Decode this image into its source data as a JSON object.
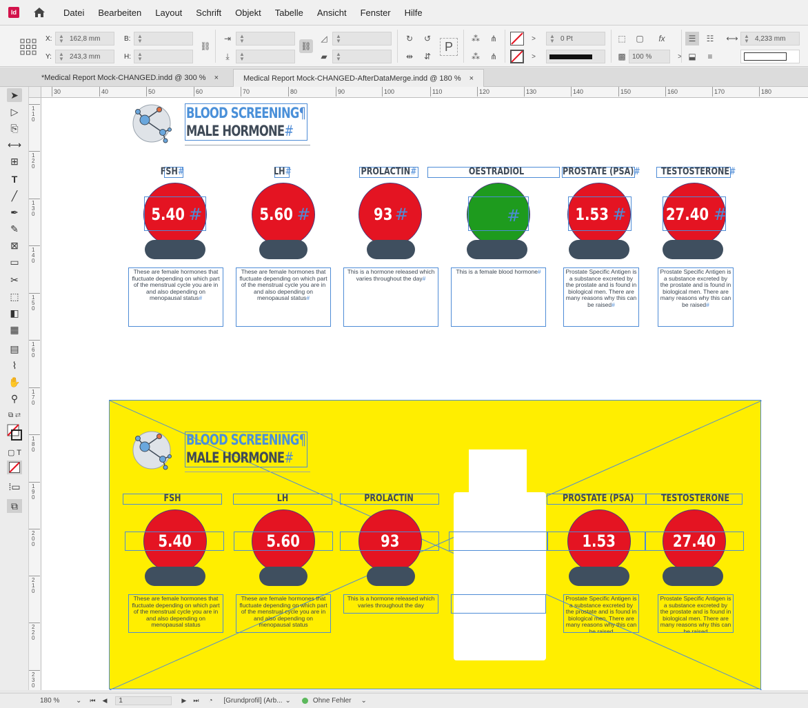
{
  "app": {
    "icon_text": "Id"
  },
  "menu": [
    "Datei",
    "Bearbeiten",
    "Layout",
    "Schrift",
    "Objekt",
    "Tabelle",
    "Ansicht",
    "Fenster",
    "Hilfe"
  ],
  "control": {
    "x_label": "X:",
    "x_value": "162,8 mm",
    "y_label": "Y:",
    "y_value": "243,3 mm",
    "w_label": "B:",
    "h_label": "H:",
    "stroke_weight": "0 Pt",
    "opacity": "100 %",
    "size_value": "4,233 mm"
  },
  "tabs": [
    {
      "label": "*Medical Report Mock-CHANGED.indd @ 300 %",
      "close": "×"
    },
    {
      "label": "Medical Report Mock-CHANGED-AfterDataMerge.indd @ 180 %",
      "close": "×"
    }
  ],
  "ruler": {
    "h_ticks": [
      "30",
      "40",
      "50",
      "60",
      "70",
      "80",
      "90",
      "100",
      "110",
      "120",
      "130",
      "140",
      "150",
      "160",
      "170",
      "180"
    ],
    "v_ticks": [
      "110",
      "120",
      "130",
      "140",
      "150",
      "160",
      "170",
      "180",
      "190",
      "200",
      "210",
      "220",
      "230",
      "240"
    ]
  },
  "report": {
    "title_line1": "BLOOD SCREENING",
    "title_line2": "MALE HORMONE",
    "pilcrow": "¶",
    "hash": "#",
    "hormones": [
      {
        "name": "FSH",
        "value": "5.40",
        "desc": "These are female hormones that fluctuate depending on which part of the menstrual cycle you are in and also depending on menopausal status"
      },
      {
        "name": "LH",
        "value": "5.60",
        "desc": "These are female hormones that fluctuate depending on which part of the menstrual cycle you are in and also depending on menopausal status"
      },
      {
        "name": "PROLACTIN",
        "value": "93",
        "desc": "This is a hormone released which varies throughout the day"
      },
      {
        "name": "OESTRADIOL",
        "value": "",
        "desc": "This is a female blood hormone"
      },
      {
        "name": "PROSTATE (PSA)",
        "value": "1.53",
        "desc": "Prostate Specific Antigen is a substance excreted by the prostate and is found in biological men. There are many reasons why this can be raised"
      },
      {
        "name": "TESTOSTERONE",
        "value": "27.40",
        "desc": "Prostate Specific Antigen is a substance excreted by the prostate and is found in biological men. There are many reasons why this can be raised"
      }
    ]
  },
  "status": {
    "zoom": "180 %",
    "page": "1",
    "profile": "[Grundprofil] (Arb...",
    "preflight": "Ohne Fehler"
  },
  "colors": {
    "red_circle": "#e41422",
    "green_circle": "#1e9b1e",
    "base": "#3f4f5f",
    "yellow_bg": "#ffee00",
    "frame_blue": "#4d8bd6"
  }
}
